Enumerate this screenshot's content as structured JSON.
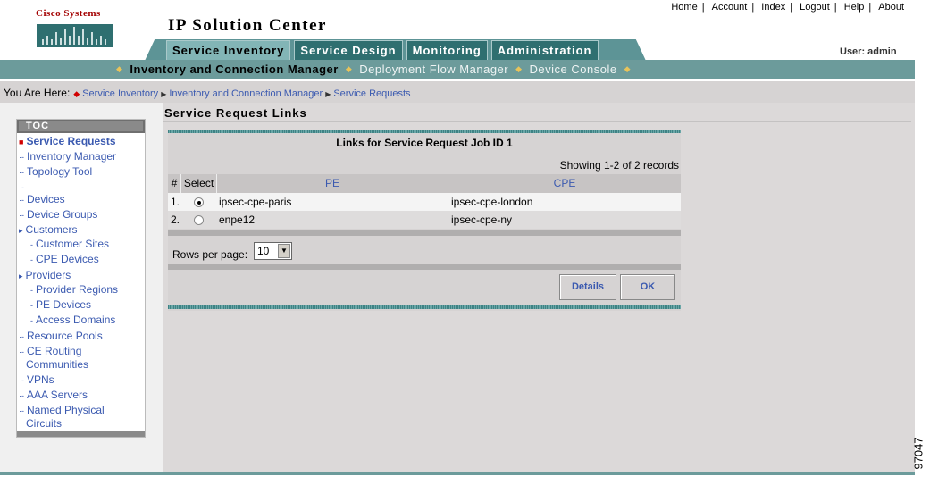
{
  "header": {
    "logo_text": "Cisco Systems",
    "app_title": "IP Solution Center",
    "top_links": [
      "Home",
      "Account",
      "Index",
      "Logout",
      "Help",
      "About"
    ],
    "user_label": "User: admin"
  },
  "tabs": [
    {
      "label": "Service Inventory",
      "active": true
    },
    {
      "label": "Service Design",
      "active": false
    },
    {
      "label": "Monitoring",
      "active": false
    },
    {
      "label": "Administration",
      "active": false
    }
  ],
  "subnav": [
    {
      "label": "Inventory and Connection Manager",
      "active": true
    },
    {
      "label": "Deployment Flow Manager",
      "active": false
    },
    {
      "label": "Device Console",
      "active": false
    }
  ],
  "breadcrumb": {
    "label": "You Are Here:",
    "items": [
      "Service Inventory",
      "Inventory and Connection Manager",
      "Service Requests"
    ]
  },
  "page_title": "Service Request Links",
  "toc": {
    "title": "TOC",
    "items": [
      {
        "label": "Service Requests",
        "active": true
      },
      {
        "label": "Inventory Manager"
      },
      {
        "label": "Topology Tool"
      },
      {
        "label": ""
      },
      {
        "label": "Devices"
      },
      {
        "label": "Device Groups"
      },
      {
        "label": "Customers"
      },
      {
        "label": "Customer Sites"
      },
      {
        "label": "CPE Devices"
      },
      {
        "label": "Providers"
      },
      {
        "label": "Provider Regions"
      },
      {
        "label": "PE Devices"
      },
      {
        "label": "Access Domains"
      },
      {
        "label": "Resource Pools"
      },
      {
        "label": "CE Routing"
      },
      {
        "label": "Communities"
      },
      {
        "label": "VPNs"
      },
      {
        "label": "AAA Servers"
      },
      {
        "label": "Named Physical"
      },
      {
        "label": "Circuits"
      }
    ]
  },
  "table": {
    "title": "Links for Service Request Job ID 1",
    "showing": "Showing 1-2 of 2 records",
    "columns": [
      "#",
      "Select",
      "PE",
      "CPE"
    ],
    "rows": [
      {
        "num": "1.",
        "selected": true,
        "pe": "ipsec-cpe-paris",
        "cpe": "ipsec-cpe-london"
      },
      {
        "num": "2.",
        "selected": false,
        "pe": "enpe12",
        "cpe": "ipsec-cpe-ny"
      }
    ],
    "rows_per_page_label": "Rows per page:",
    "rows_per_page_value": "10",
    "buttons": {
      "details": "Details",
      "ok": "OK"
    }
  },
  "figure_number": "97047"
}
